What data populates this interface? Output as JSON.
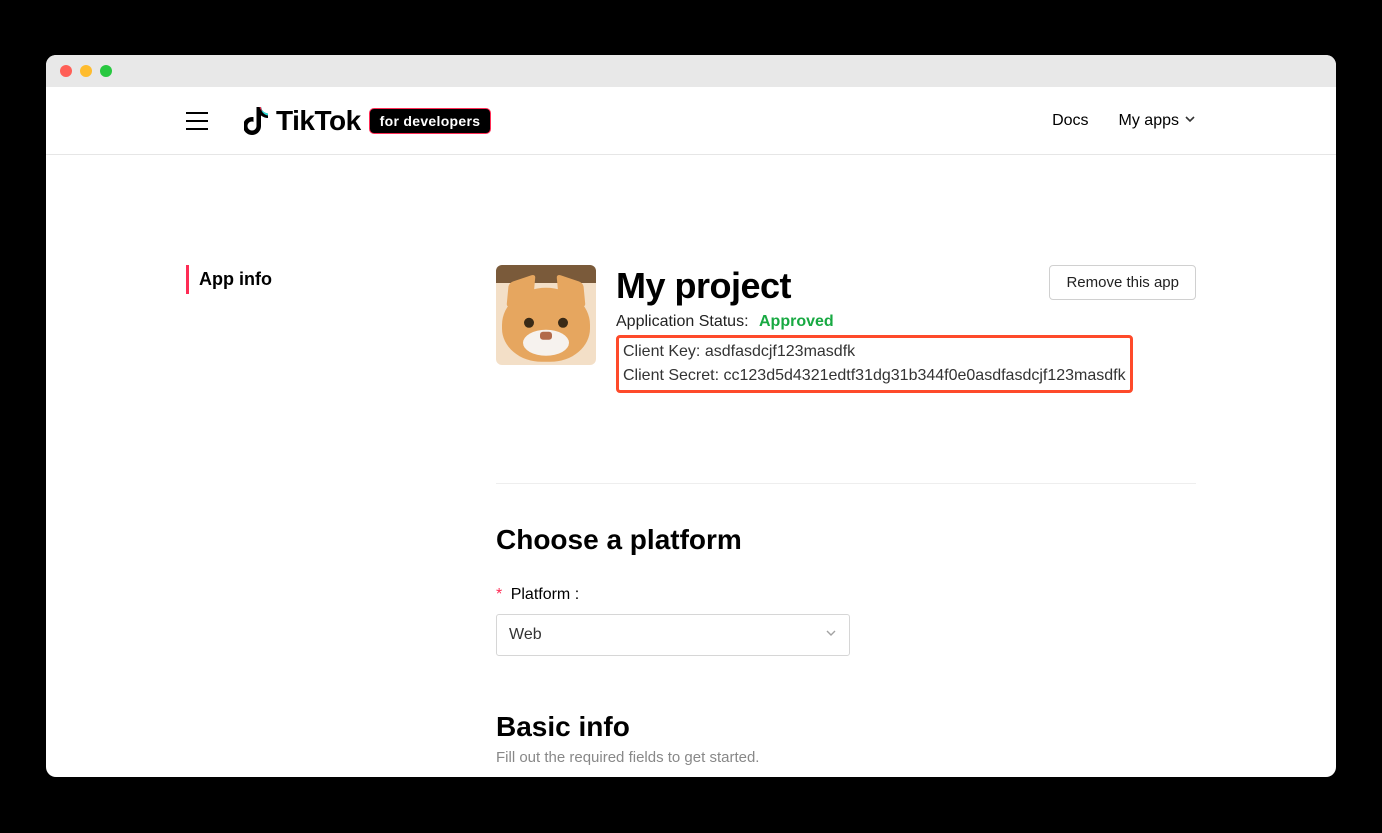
{
  "nav": {
    "docs": "Docs",
    "myapps": "My apps"
  },
  "logo": {
    "text": "TikTok",
    "badge": "for developers"
  },
  "sidebar": {
    "app_info": "App info"
  },
  "app": {
    "title": "My project",
    "status_label": "Application Status:",
    "status_value": "Approved",
    "client_key_label": "Client Key:",
    "client_key_value": "asdfasdcjf123masdfk",
    "client_secret_label": "Client Secret:",
    "client_secret_value": "cc123d5d4321edtf31dg31b344f0e0asdfasdcjf123masdfk",
    "remove_label": "Remove this app"
  },
  "platform": {
    "section_title": "Choose a platform",
    "label": "Platform",
    "selected": "Web"
  },
  "basic": {
    "title": "Basic info",
    "subtitle": "Fill out the required fields to get started."
  }
}
